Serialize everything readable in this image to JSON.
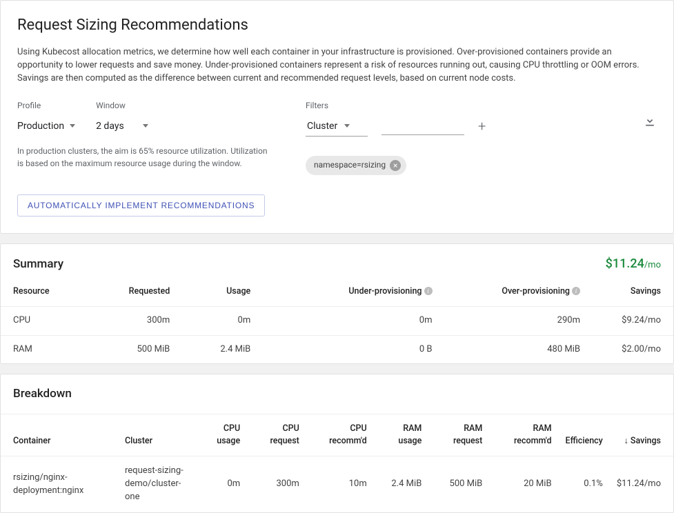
{
  "header": {
    "title": "Request Sizing Recommendations",
    "description": "Using Kubecost allocation metrics, we determine how well each container in your infrastructure is provisioned. Over-provisioned containers provide an opportunity to lower requests and save money. Under-provisioned containers represent a risk of resources running out, causing CPU throttling or OOM errors. Savings are then computed as the difference between current and recommended request levels, based on current node costs."
  },
  "controls": {
    "profile": {
      "label": "Profile",
      "value": "Production"
    },
    "window": {
      "label": "Window",
      "value": "2 days"
    },
    "hint": "In production clusters, the aim is 65% resource utilization. Utilization is based on the maximum resource usage during the window.",
    "filters": {
      "label": "Filters",
      "type_value": "Cluster",
      "chips": [
        {
          "label": "namespace=rsizing"
        }
      ]
    },
    "auto_button": "Automatically Implement Recommendations"
  },
  "summary": {
    "title": "Summary",
    "total_value": "$11.24",
    "total_unit": "/mo",
    "columns": {
      "resource": "Resource",
      "requested": "Requested",
      "usage": "Usage",
      "under": "Under-provisioning",
      "over": "Over-provisioning",
      "savings": "Savings"
    },
    "rows": [
      {
        "resource": "CPU",
        "requested": "300m",
        "usage": "0m",
        "under": "0m",
        "over": "290m",
        "savings": "$9.24/mo"
      },
      {
        "resource": "RAM",
        "requested": "500 MiB",
        "usage": "2.4 MiB",
        "under": "0 B",
        "over": "480 MiB",
        "savings": "$2.00/mo"
      }
    ]
  },
  "breakdown": {
    "title": "Breakdown",
    "columns": {
      "container": "Container",
      "cluster": "Cluster",
      "cpu_usage": "CPU usage",
      "cpu_request": "CPU request",
      "cpu_recommd": "CPU recomm'd",
      "ram_usage": "RAM usage",
      "ram_request": "RAM request",
      "ram_recommd": "RAM recomm'd",
      "efficiency": "Efficiency",
      "savings": "Savings"
    },
    "rows": [
      {
        "container": "rsizing/nginx-deployment:nginx",
        "cluster": "request-sizing-demo/cluster-one",
        "cpu_usage": "0m",
        "cpu_request": "300m",
        "cpu_recommd": "10m",
        "ram_usage": "2.4 MiB",
        "ram_request": "500 MiB",
        "ram_recommd": "20 MiB",
        "efficiency": "0.1%",
        "savings": "$11.24/mo"
      }
    ]
  }
}
